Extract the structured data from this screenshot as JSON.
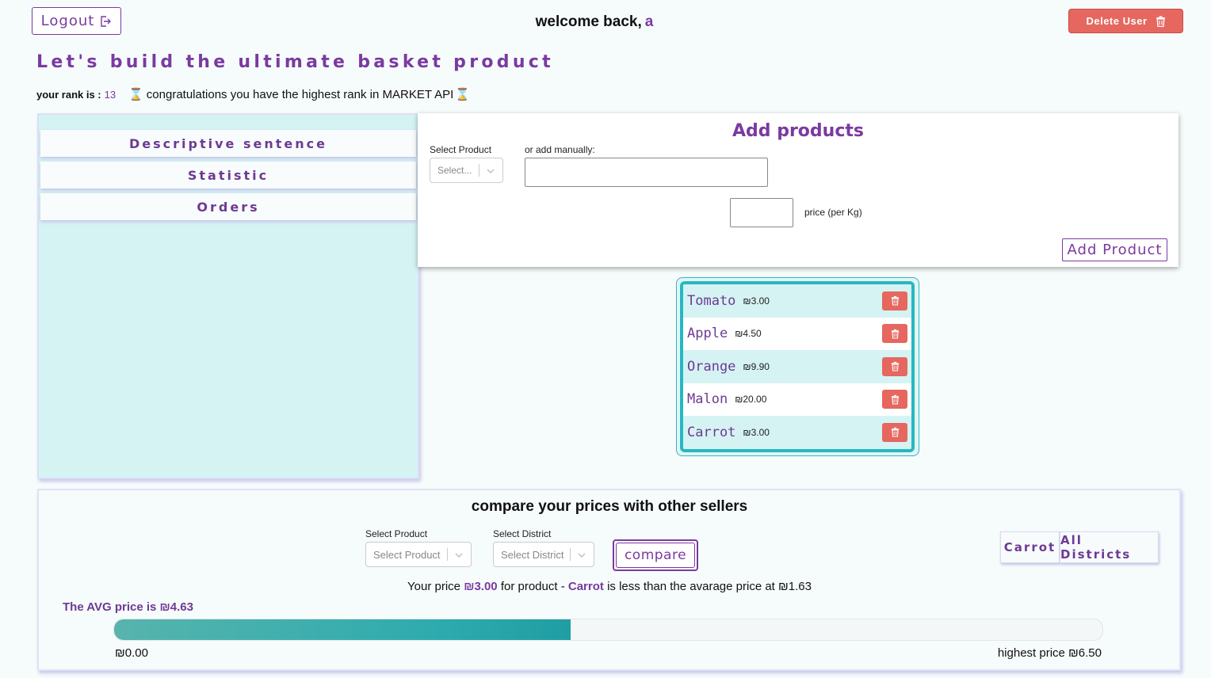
{
  "header": {
    "logout_label": "Logout",
    "welcome_text": "welcome back,",
    "username": "a",
    "delete_user_label": "Delete User"
  },
  "headline": "Let's build the ultimate basket product",
  "rank": {
    "label": "your rank is :",
    "value": "13",
    "message": "congratulations you have the highest rank in MARKET API"
  },
  "nav": {
    "items": [
      "Descriptive sentence",
      "Statistic",
      "Orders"
    ]
  },
  "add_products": {
    "title": "Add products",
    "select_label": "Select Product",
    "select_placeholder": "Select...",
    "manual_label": "or add manually:",
    "manual_value": "",
    "price_value": "",
    "price_label": "price (per Kg)",
    "add_button_label": "Add Product"
  },
  "products": [
    {
      "name": "Tomato",
      "price": "₪3.00"
    },
    {
      "name": "Apple",
      "price": "₪4.50"
    },
    {
      "name": "Orange",
      "price": "₪9.90"
    },
    {
      "name": "Malon",
      "price": "₪20.00"
    },
    {
      "name": "Carrot",
      "price": "₪3.00"
    }
  ],
  "compare": {
    "title": "compare your prices with other sellers",
    "product_label": "Select Product",
    "product_placeholder": "Select Product",
    "district_label": "Select District",
    "district_placeholder": "Select District",
    "button_label": "compare",
    "chip_product": "Carrot",
    "chip_district": "All Districts",
    "result_prefix": "Your price",
    "result_price": "₪3.00",
    "result_mid": "for product -",
    "result_product": "Carrot",
    "result_suffix": "is less than the avarage price at ₪1.63",
    "avg_label": "The AVG price is ₪4.63",
    "progress_fraction": 0.462,
    "min_label": "₪0.00",
    "max_label": "highest price ₪6.50"
  },
  "colors": {
    "accent": "#7a3aa0",
    "danger": "#e5675f",
    "teal": "#27b7c0",
    "panel_bg": "#d5f3f3"
  },
  "icons": {
    "logout": "logout-icon",
    "trash": "trash-icon",
    "trophy": "trophy-icon",
    "chevron": "chevron-down-icon"
  }
}
